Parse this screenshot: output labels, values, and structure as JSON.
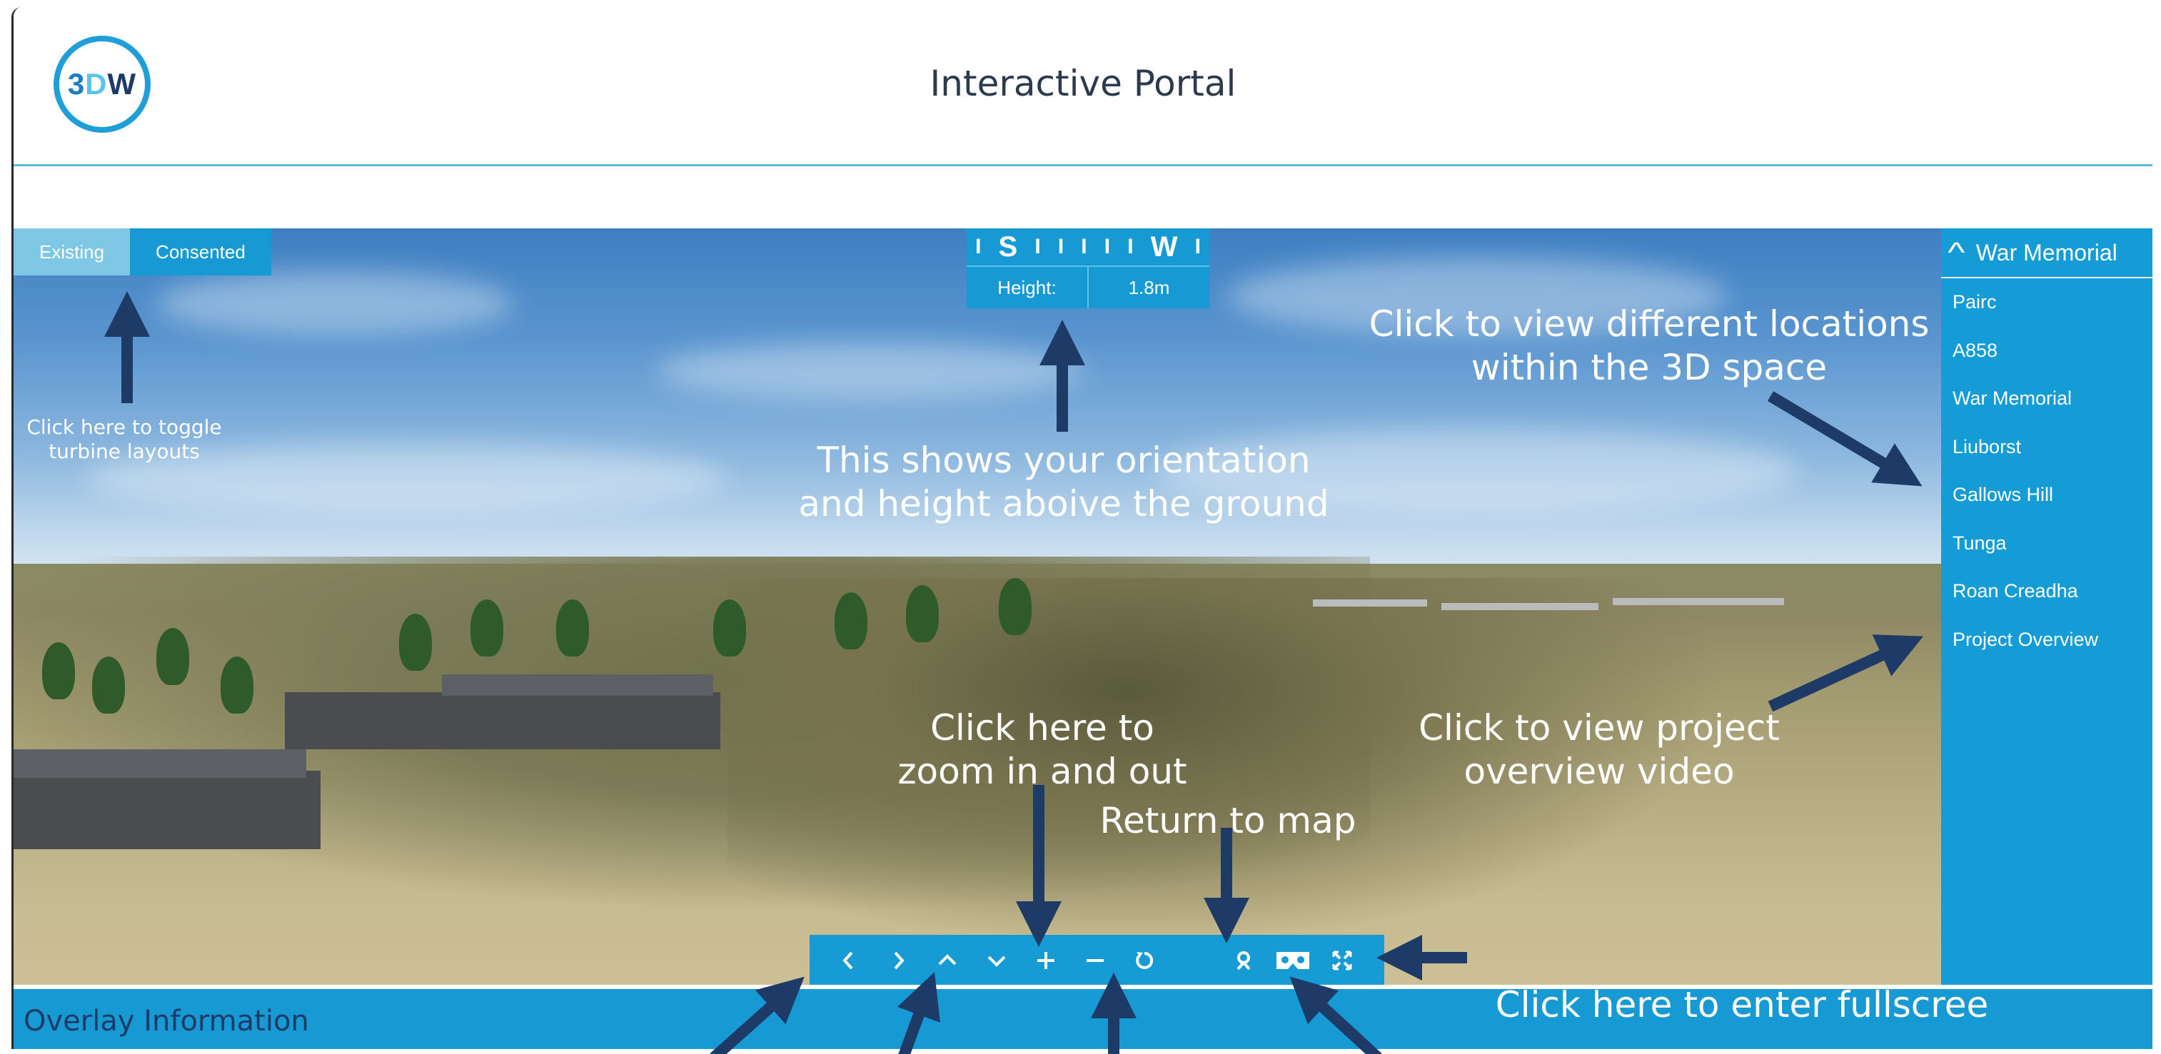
{
  "header": {
    "logo": {
      "p1": "3",
      "p2": "D",
      "p3": "W"
    },
    "title": "Interactive Portal"
  },
  "layout_toggle": {
    "existing": "Existing",
    "consented": "Consented"
  },
  "compass": {
    "s": "S",
    "w": "W",
    "height_label": "Height:",
    "height_value": "1.8m"
  },
  "locations": {
    "current": "War Memorial",
    "items": [
      "Pairc",
      "A858",
      "War Memorial",
      "Liuborst",
      "Gallows Hill",
      "Tunga",
      "Roan Creadha",
      "Project Overview"
    ]
  },
  "toolbar": {
    "icons": [
      "chevron-left-icon",
      "chevron-right-icon",
      "chevron-up-icon",
      "chevron-down-icon",
      "plus-icon",
      "minus-icon",
      "reset-icon",
      "map-pin-icon",
      "vr-headset-icon",
      "fullscreen-icon"
    ]
  },
  "overlay": {
    "label": "Overlay Information"
  },
  "annotations": {
    "toggle": [
      "Click here to toggle",
      "turbine layouts"
    ],
    "orientation": [
      "This shows your orientation",
      "and height aboive the ground"
    ],
    "locations": [
      "Click to view different locations",
      "within the 3D space"
    ],
    "overview": [
      "Click to view project",
      "overview video"
    ],
    "zoom": [
      "Click here to",
      "zoom in and out"
    ],
    "map": "Return to map",
    "fullscreen": "Click here to enter fullscree"
  },
  "colors": {
    "accent": "#179ad4",
    "accent_light": "#7ec8e6",
    "arrow": "#1d3b66",
    "logo_ring": "#1e9fd8"
  }
}
